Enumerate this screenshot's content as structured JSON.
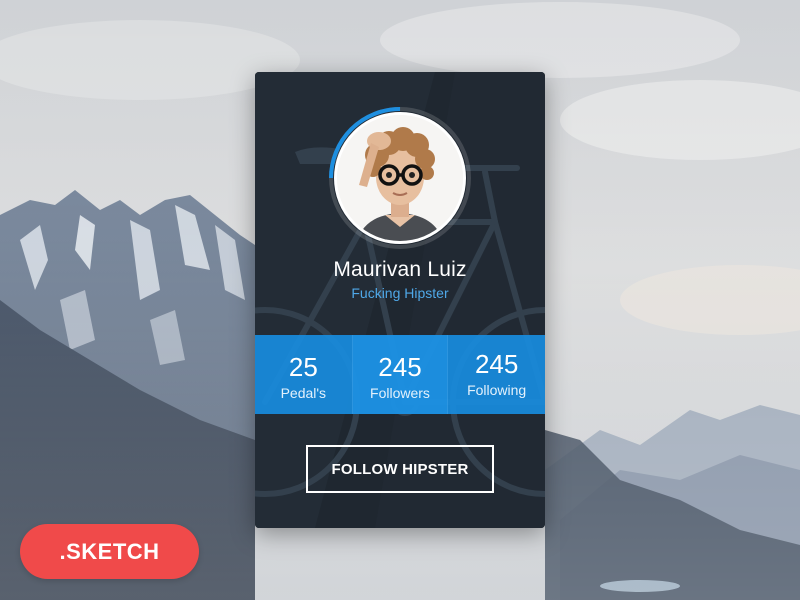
{
  "profile": {
    "name": "Maurivan Luiz",
    "subtitle": "Fucking Hipster",
    "avatar_progress": 0.25
  },
  "stats": [
    {
      "value": "25",
      "label": "Pedal's"
    },
    {
      "value": "245",
      "label": "Followers"
    },
    {
      "value": "245",
      "label": "Following"
    }
  ],
  "actions": {
    "follow_label": "FOLLOW HIPSTER"
  },
  "badge": {
    "label": ".SKETCH"
  },
  "colors": {
    "accent": "#1e8fe0",
    "card_bg": "#1f2730",
    "badge": "#f04a4a",
    "subtitle": "#4fa8e8"
  },
  "icons": {
    "background": "mountain-landscape",
    "card_art": "bicycle-illustration"
  }
}
